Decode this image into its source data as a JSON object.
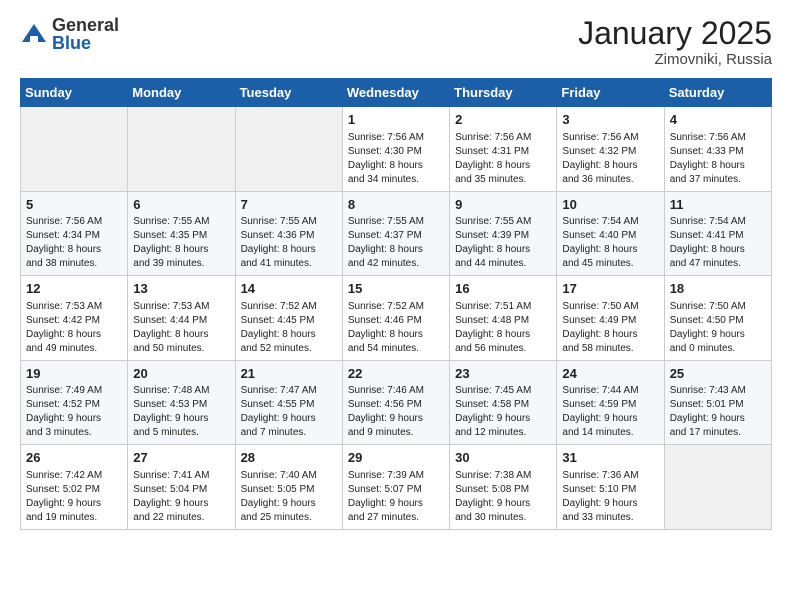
{
  "logo": {
    "general": "General",
    "blue": "Blue"
  },
  "title": "January 2025",
  "location": "Zimovniki, Russia",
  "weekdays": [
    "Sunday",
    "Monday",
    "Tuesday",
    "Wednesday",
    "Thursday",
    "Friday",
    "Saturday"
  ],
  "weeks": [
    [
      {
        "day": "",
        "info": ""
      },
      {
        "day": "",
        "info": ""
      },
      {
        "day": "",
        "info": ""
      },
      {
        "day": "1",
        "info": "Sunrise: 7:56 AM\nSunset: 4:30 PM\nDaylight: 8 hours\nand 34 minutes."
      },
      {
        "day": "2",
        "info": "Sunrise: 7:56 AM\nSunset: 4:31 PM\nDaylight: 8 hours\nand 35 minutes."
      },
      {
        "day": "3",
        "info": "Sunrise: 7:56 AM\nSunset: 4:32 PM\nDaylight: 8 hours\nand 36 minutes."
      },
      {
        "day": "4",
        "info": "Sunrise: 7:56 AM\nSunset: 4:33 PM\nDaylight: 8 hours\nand 37 minutes."
      }
    ],
    [
      {
        "day": "5",
        "info": "Sunrise: 7:56 AM\nSunset: 4:34 PM\nDaylight: 8 hours\nand 38 minutes."
      },
      {
        "day": "6",
        "info": "Sunrise: 7:55 AM\nSunset: 4:35 PM\nDaylight: 8 hours\nand 39 minutes."
      },
      {
        "day": "7",
        "info": "Sunrise: 7:55 AM\nSunset: 4:36 PM\nDaylight: 8 hours\nand 41 minutes."
      },
      {
        "day": "8",
        "info": "Sunrise: 7:55 AM\nSunset: 4:37 PM\nDaylight: 8 hours\nand 42 minutes."
      },
      {
        "day": "9",
        "info": "Sunrise: 7:55 AM\nSunset: 4:39 PM\nDaylight: 8 hours\nand 44 minutes."
      },
      {
        "day": "10",
        "info": "Sunrise: 7:54 AM\nSunset: 4:40 PM\nDaylight: 8 hours\nand 45 minutes."
      },
      {
        "day": "11",
        "info": "Sunrise: 7:54 AM\nSunset: 4:41 PM\nDaylight: 8 hours\nand 47 minutes."
      }
    ],
    [
      {
        "day": "12",
        "info": "Sunrise: 7:53 AM\nSunset: 4:42 PM\nDaylight: 8 hours\nand 49 minutes."
      },
      {
        "day": "13",
        "info": "Sunrise: 7:53 AM\nSunset: 4:44 PM\nDaylight: 8 hours\nand 50 minutes."
      },
      {
        "day": "14",
        "info": "Sunrise: 7:52 AM\nSunset: 4:45 PM\nDaylight: 8 hours\nand 52 minutes."
      },
      {
        "day": "15",
        "info": "Sunrise: 7:52 AM\nSunset: 4:46 PM\nDaylight: 8 hours\nand 54 minutes."
      },
      {
        "day": "16",
        "info": "Sunrise: 7:51 AM\nSunset: 4:48 PM\nDaylight: 8 hours\nand 56 minutes."
      },
      {
        "day": "17",
        "info": "Sunrise: 7:50 AM\nSunset: 4:49 PM\nDaylight: 8 hours\nand 58 minutes."
      },
      {
        "day": "18",
        "info": "Sunrise: 7:50 AM\nSunset: 4:50 PM\nDaylight: 9 hours\nand 0 minutes."
      }
    ],
    [
      {
        "day": "19",
        "info": "Sunrise: 7:49 AM\nSunset: 4:52 PM\nDaylight: 9 hours\nand 3 minutes."
      },
      {
        "day": "20",
        "info": "Sunrise: 7:48 AM\nSunset: 4:53 PM\nDaylight: 9 hours\nand 5 minutes."
      },
      {
        "day": "21",
        "info": "Sunrise: 7:47 AM\nSunset: 4:55 PM\nDaylight: 9 hours\nand 7 minutes."
      },
      {
        "day": "22",
        "info": "Sunrise: 7:46 AM\nSunset: 4:56 PM\nDaylight: 9 hours\nand 9 minutes."
      },
      {
        "day": "23",
        "info": "Sunrise: 7:45 AM\nSunset: 4:58 PM\nDaylight: 9 hours\nand 12 minutes."
      },
      {
        "day": "24",
        "info": "Sunrise: 7:44 AM\nSunset: 4:59 PM\nDaylight: 9 hours\nand 14 minutes."
      },
      {
        "day": "25",
        "info": "Sunrise: 7:43 AM\nSunset: 5:01 PM\nDaylight: 9 hours\nand 17 minutes."
      }
    ],
    [
      {
        "day": "26",
        "info": "Sunrise: 7:42 AM\nSunset: 5:02 PM\nDaylight: 9 hours\nand 19 minutes."
      },
      {
        "day": "27",
        "info": "Sunrise: 7:41 AM\nSunset: 5:04 PM\nDaylight: 9 hours\nand 22 minutes."
      },
      {
        "day": "28",
        "info": "Sunrise: 7:40 AM\nSunset: 5:05 PM\nDaylight: 9 hours\nand 25 minutes."
      },
      {
        "day": "29",
        "info": "Sunrise: 7:39 AM\nSunset: 5:07 PM\nDaylight: 9 hours\nand 27 minutes."
      },
      {
        "day": "30",
        "info": "Sunrise: 7:38 AM\nSunset: 5:08 PM\nDaylight: 9 hours\nand 30 minutes."
      },
      {
        "day": "31",
        "info": "Sunrise: 7:36 AM\nSunset: 5:10 PM\nDaylight: 9 hours\nand 33 minutes."
      },
      {
        "day": "",
        "info": ""
      }
    ]
  ]
}
